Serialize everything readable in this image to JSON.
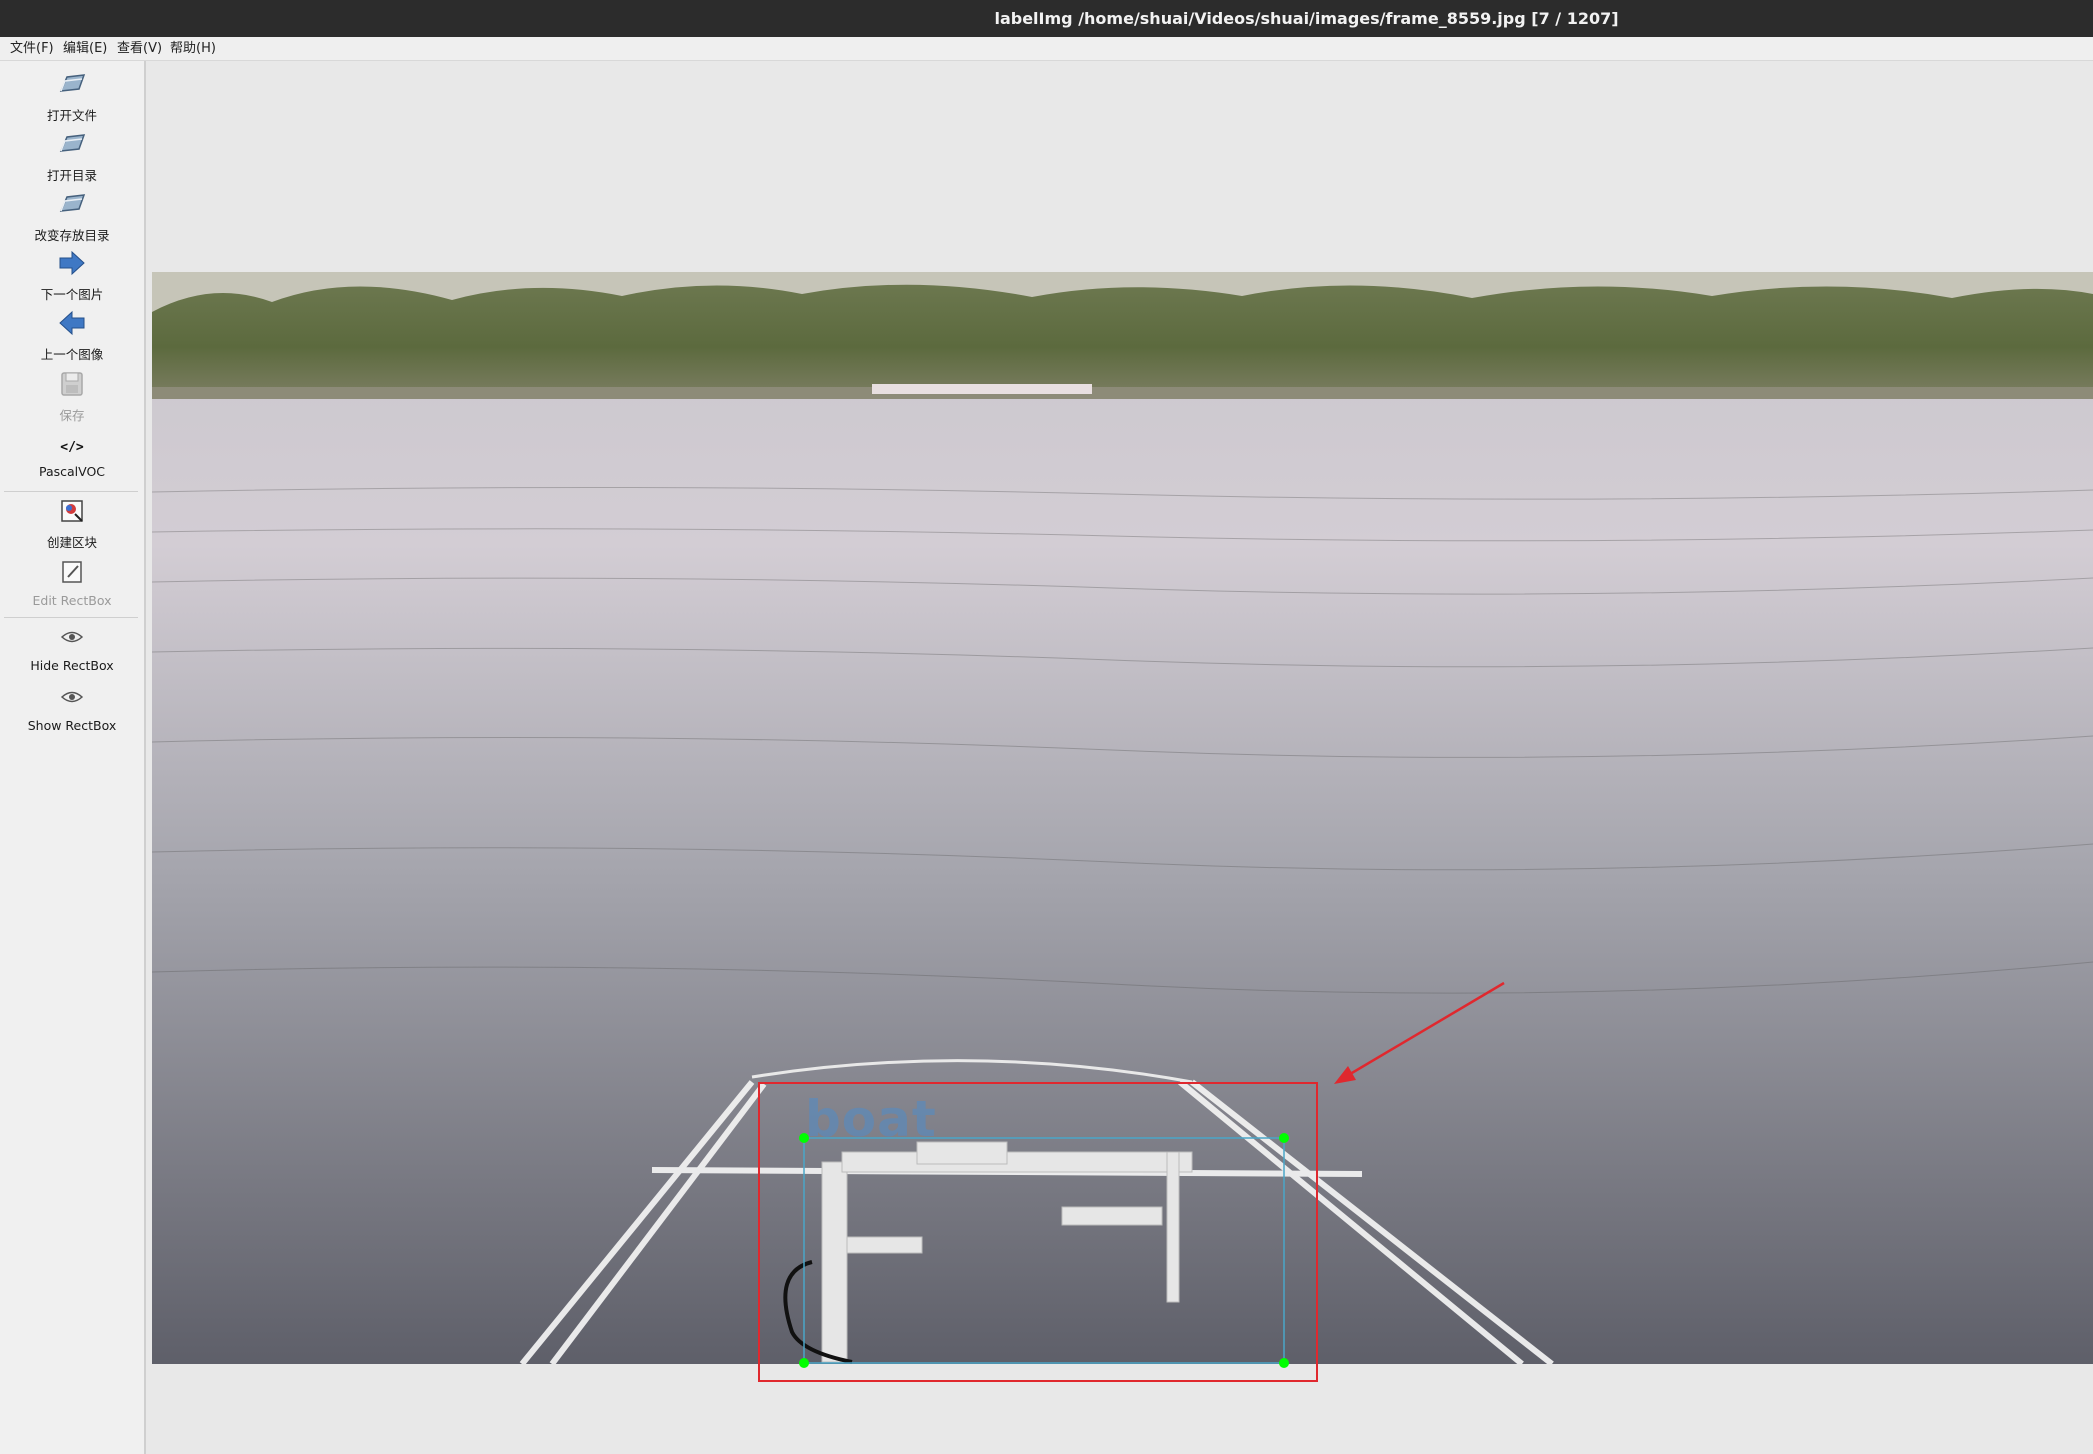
{
  "window": {
    "title": "labelImg /home/shuai/Videos/shuai/images/frame_8559.jpg [7 / 1207]"
  },
  "menu": {
    "file": "文件(F)",
    "edit": "编辑(E)",
    "view": "查看(V)",
    "help": "帮助(H)"
  },
  "toolbar": {
    "open_file": "打开文件",
    "open_dir": "打开目录",
    "change_save_dir": "改变存放目录",
    "next_image": "下一个图片",
    "prev_image": "上一个图像",
    "save": "保存",
    "format": "PascalVOC",
    "create_rectbox": "创建区块",
    "edit_rectbox": "Edit RectBox",
    "hide_rectbox": "Hide RectBox",
    "show_rectbox": "Show RectBox"
  },
  "annotation": {
    "label": "boat",
    "box_color": "#4aa6c8",
    "highlight_color": "#e0282e",
    "vertex_color": "#00ff00"
  }
}
